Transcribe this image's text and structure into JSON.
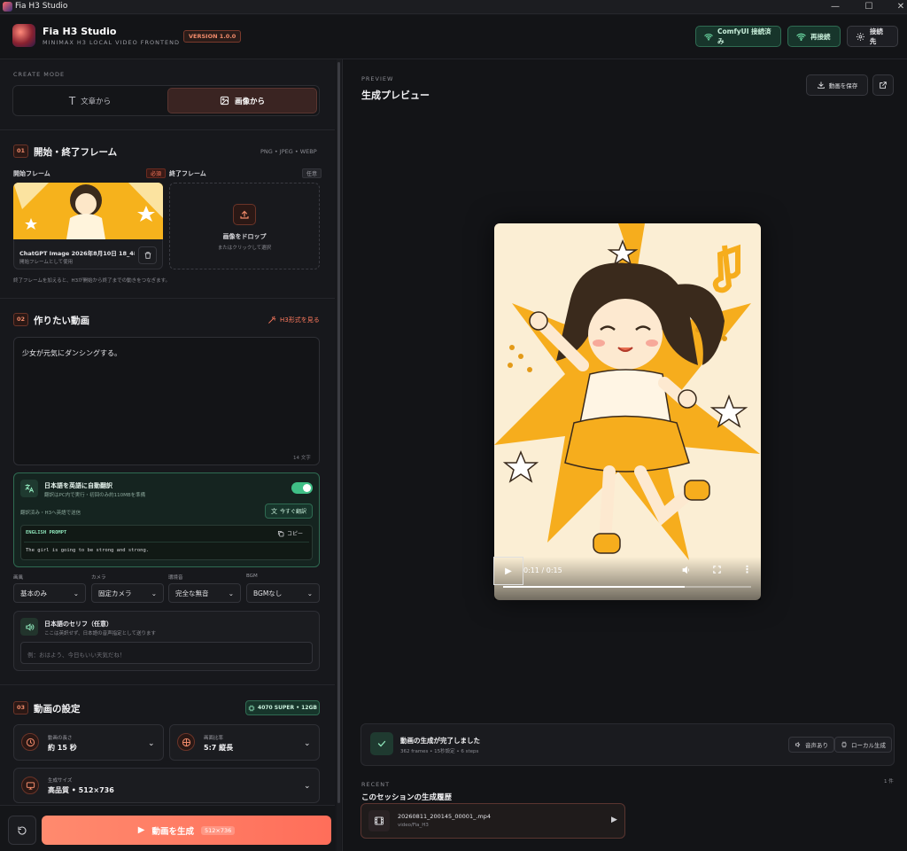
{
  "window": {
    "title": "Fia H3 Studio"
  },
  "header": {
    "app_name": "Fia H3 Studio",
    "subtitle": "MINIMAX H3 LOCAL VIDEO FRONTEND",
    "version": "VERSION 1.0.0",
    "status_button": "ComfyUI 接続済み",
    "reconnect_button": "再接続",
    "settings_button": "接続先"
  },
  "create_mode": {
    "label": "CREATE MODE",
    "text_mode": "文章から",
    "image_mode": "画像から",
    "selected": "画像から"
  },
  "section1": {
    "num": "01",
    "title": "開始・終了フレーム",
    "formats": "PNG • JPEG • WEBP",
    "start_label": "開始フレーム",
    "start_tag": "必須",
    "end_label": "終了フレーム",
    "end_tag": "任意",
    "start_file": "ChatGPT Image 2026年8月10日 18_48_0...",
    "start_file_sub": "開始フレームとして使用",
    "drop_title": "画像をドロップ",
    "drop_sub": "またはクリックして選択",
    "hint": "終了フレームを加えると、H3が開始から終了までの動きをつなぎます。"
  },
  "section2": {
    "num": "02",
    "title": "作りたい動画",
    "h3_link": "H3形式を見る",
    "prompt": "少女が元気にダンシングする。",
    "char_count": "14 文字",
    "translate_title": "日本語を英語に自動翻訳",
    "translate_sub": "翻訳はPC内で実行・初回のみ約110MBを準備",
    "translate_status": "翻訳済み・H3へ英語で送信",
    "translate_now": "今すぐ翻訳",
    "english_label": "ENGLISH PROMPT",
    "copy_label": "コピー",
    "english_prompt": "The girl is going to be strong and strong.",
    "toggle_on": true,
    "selects": [
      {
        "label": "画風",
        "value": "基本のみ"
      },
      {
        "label": "カメラ",
        "value": "固定カメラ"
      },
      {
        "label": "環境音",
        "value": "完全な無音"
      },
      {
        "label": "BGM",
        "value": "BGMなし"
      }
    ],
    "dialogue_title": "日本語のセリフ（任意）",
    "dialogue_sub": "ここは英訳せず、日本語の音声指定として送ります",
    "dialogue_placeholder": "例：おはよう、今日もいい天気だね！"
  },
  "section3": {
    "num": "03",
    "title": "動画の設定",
    "gpu_badge": "4070 SUPER • 12GB",
    "length_label": "動画の長さ",
    "length_value": "約 15 秒",
    "ratio_label": "画面比率",
    "ratio_value": "5:7 縦長",
    "size_label": "生成サイズ",
    "size_value": "高品質 • 512×736"
  },
  "actions": {
    "generate": "動画を生成",
    "generate_badge": "512×736"
  },
  "preview": {
    "label": "PREVIEW",
    "title": "生成プレビュー",
    "save_button": "動画を保存",
    "time": "0:11 / 0:15",
    "progress": 0.733
  },
  "status": {
    "title": "動画の生成が完了しました",
    "detail": "362 frames • 15秒設定 • 6 steps",
    "audio_chip": "音声あり",
    "local_chip": "ローカル生成"
  },
  "recent": {
    "label": "RECENT",
    "count": "1 件",
    "title": "このセッションの生成履歴",
    "items": [
      {
        "file": "20260811_200145_00001_.mp4",
        "path": "video/Fia_H3"
      }
    ]
  },
  "colors": {
    "accent": "#ff7a5e",
    "green": "#3fbf86",
    "bg": "#16171b"
  }
}
